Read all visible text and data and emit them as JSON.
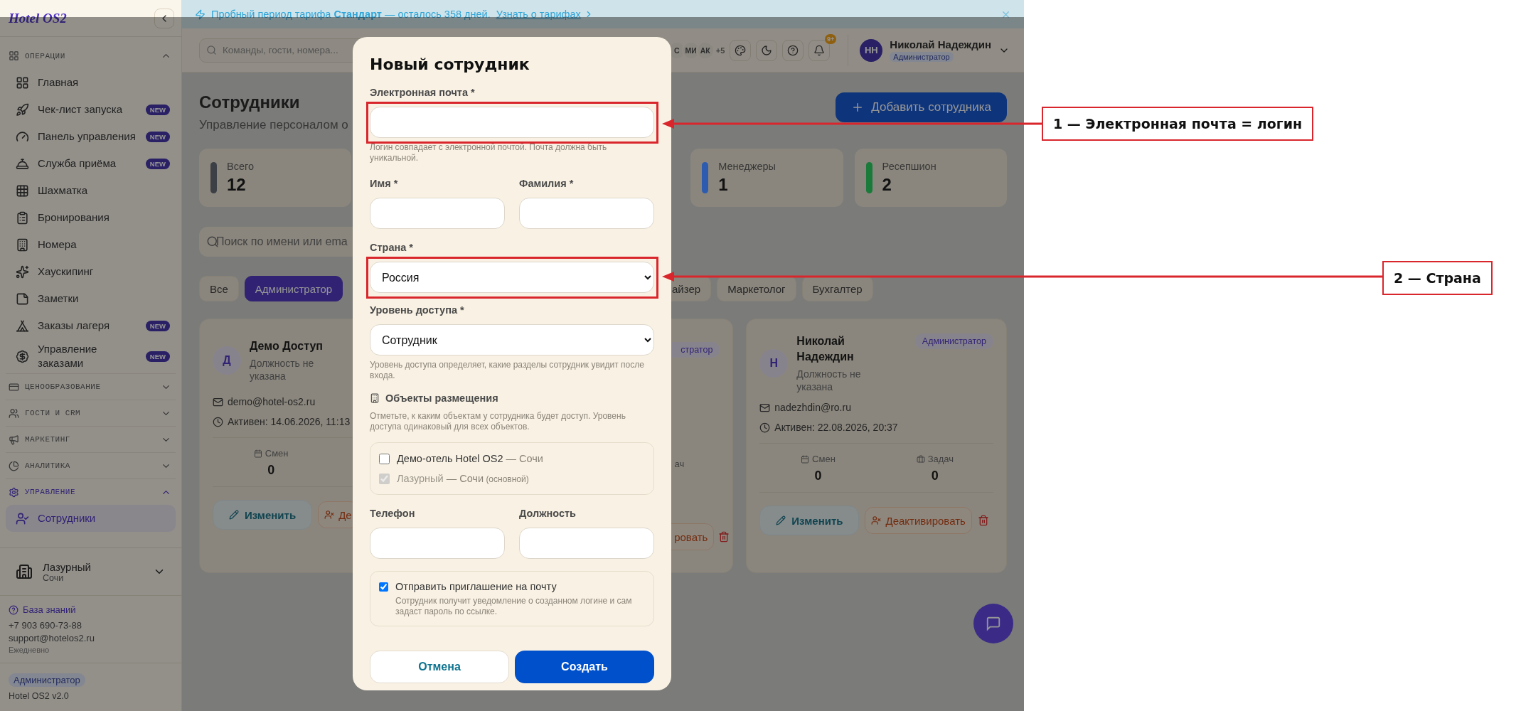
{
  "sidebar": {
    "logo": "Hotel OS2",
    "sections": [
      {
        "title": "ОПЕРАЦИИ",
        "expanded": true,
        "items": [
          {
            "label": "Главная",
            "selected": false
          },
          {
            "label": "Чек-лист запуска",
            "badge": "NEW",
            "selected": false
          },
          {
            "label": "Панель управления",
            "badge": "NEW",
            "selected": false
          },
          {
            "label": "Служба приёма",
            "badge": "NEW",
            "selected": false
          },
          {
            "label": "Шахматка",
            "selected": false
          },
          {
            "label": "Бронирования",
            "selected": false
          },
          {
            "label": "Номера",
            "selected": false
          },
          {
            "label": "Хаускипинг",
            "selected": false
          },
          {
            "label": "Заметки",
            "selected": false
          },
          {
            "label": "Заказы лагеря",
            "badge": "NEW",
            "selected": false
          },
          {
            "label": "Управление заказами",
            "badge": "NEW",
            "selected": false
          }
        ]
      },
      {
        "title": "ЦЕНООБРАЗОВАНИЕ",
        "expanded": false
      },
      {
        "title": "ГОСТИ И CRM",
        "expanded": false
      },
      {
        "title": "МАРКЕТИНГ",
        "expanded": false
      },
      {
        "title": "АНАЛИТИКА",
        "expanded": false
      },
      {
        "title": "УПРАВЛЕНИЕ",
        "expanded": true,
        "items": [
          {
            "label": "Сотрудники",
            "selected": true
          }
        ]
      }
    ],
    "property": {
      "name": "Лазурный",
      "city": "Сочи"
    },
    "help": {
      "link": "База знаний",
      "phone": "+7 903 690-73-88",
      "email": "support@hotelos2.ru",
      "hours": "Ежедневно"
    },
    "role": "Администратор",
    "version": "Hotel OS2 v2.0"
  },
  "banner": {
    "text": "Пробный период тарифа **Стандарт** — осталось 358 дней.",
    "link": "Узнать о тарифах"
  },
  "topbar": {
    "search_placeholder": "Команды, гости, номера...",
    "presence": [
      "С",
      "МИ",
      "АК"
    ],
    "presence_more": "+5",
    "notifications": "9+",
    "user": {
      "initials": "НН",
      "name": "Николай Надеждин",
      "role": "Администратор"
    }
  },
  "page": {
    "title": "Сотрудники",
    "subtitle": "Управление персоналом о",
    "add_button": "Добавить сотрудника",
    "stats": [
      {
        "label": "Всего",
        "value": "12",
        "color": "#3c3f45"
      },
      {
        "label": "Менеджеры",
        "value": "1",
        "color": "#2d5bb0"
      },
      {
        "label": "Ресепшион",
        "value": "2",
        "color": "#197a3a"
      }
    ],
    "search_placeholder": "Поиск по имени или ema",
    "filters": [
      {
        "label": "Все",
        "selected": false
      },
      {
        "label": "Администратор",
        "selected": true
      },
      {
        "label": "айзер",
        "selected": false
      },
      {
        "label": "Маркетолог",
        "selected": false
      },
      {
        "label": "Бухгалтер",
        "selected": false
      }
    ],
    "cards": [
      {
        "kind": "whole",
        "avatar": "Д",
        "name": "Демо Доступ",
        "position": "Должность не указана",
        "email": "demo@hotel-os2.ru",
        "active": "Активен: 14.06.2026, 11:13",
        "stats": [
          {
            "label": "Смен",
            "value": "0"
          }
        ],
        "edit": "Изменить",
        "deactivate": "Де"
      },
      {
        "kind": "fragment",
        "badge": "стратор",
        "stat_label": "ач",
        "deactivate": "ровать"
      },
      {
        "kind": "whole",
        "avatar": "Н",
        "name": "Николай Надеждин",
        "position": "Должность не указана",
        "badge": "Администратор",
        "email": "nadezhdin@ro.ru",
        "active": "Активен: 22.08.2026, 20:37",
        "stats": [
          {
            "label": "Смен",
            "value": "0"
          },
          {
            "label": "Задач",
            "value": "0"
          }
        ],
        "edit": "Изменить",
        "deactivate": "Деактивировать",
        "trash": true
      }
    ]
  },
  "modal": {
    "title": "Новый сотрудник",
    "email": {
      "label": "Электронная почта *",
      "hint": "Логин совпадает с электронной почтой. Почта должна быть уникальной.",
      "highlighted": true
    },
    "first_name": {
      "label": "Имя *"
    },
    "last_name": {
      "label": "Фамилия *"
    },
    "country": {
      "label": "Страна *",
      "value": "Россия",
      "highlighted": true
    },
    "access": {
      "label": "Уровень доступа *",
      "value": "Сотрудник",
      "hint": "Уровень доступа определяет, какие разделы сотрудник увидит после входа."
    },
    "properties": {
      "title": "Объекты размещения",
      "hint": "Отметьте, к каким объектам у сотрудника будет доступ. Уровень доступа одинаковый для всех объектов.",
      "items": [
        {
          "name": "Демо-отель Hotel OS2",
          "city": "— Сочи",
          "checked": false,
          "disabled": false
        },
        {
          "name": "Лазурный",
          "city": "— Сочи",
          "note": "(основной)",
          "checked": true,
          "disabled": true
        }
      ]
    },
    "phone": {
      "label": "Телефон"
    },
    "position": {
      "label": "Должность"
    },
    "invite": {
      "title": "Отправить приглашение на почту",
      "text": "Сотрудник получит уведомление о созданном логине и сам задаст пароль по ссылке.",
      "checked": true
    },
    "cancel": "Отмена",
    "submit": "Создать"
  },
  "annotations": [
    {
      "label": "1 — Электронная почта = логин"
    },
    {
      "label": "2 — Страна"
    }
  ]
}
